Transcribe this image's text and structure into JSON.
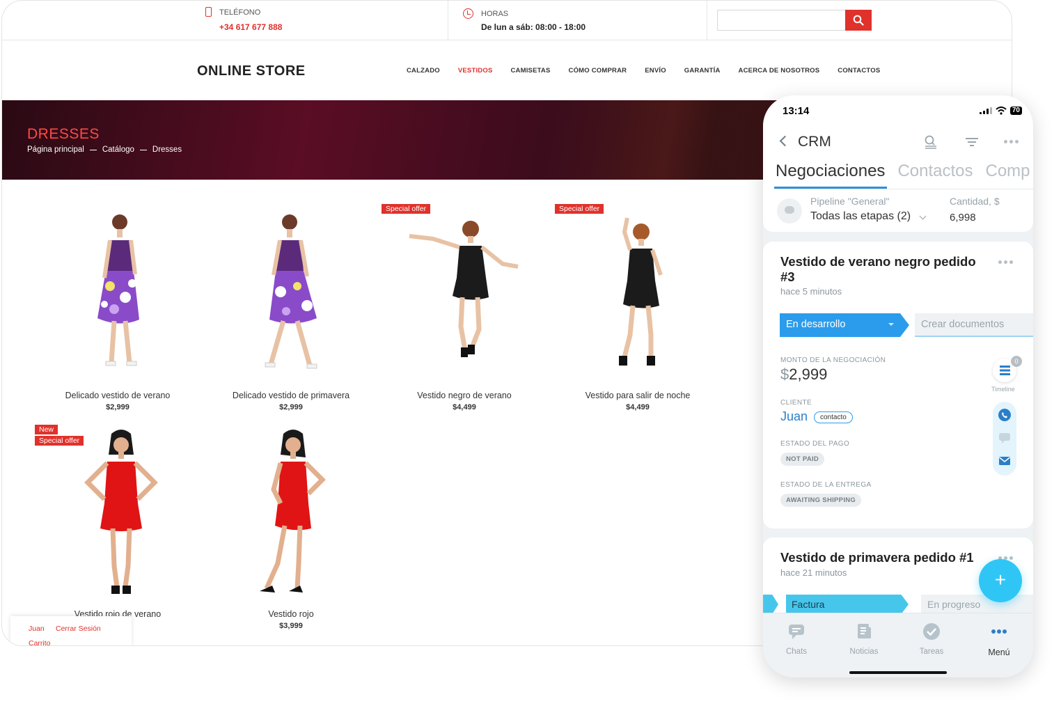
{
  "store": {
    "topbar": {
      "phone_label": "TELÉFONO",
      "phone_value": "+34 617 677 888",
      "hours_label": "HORAS",
      "hours_value": "De lun a sáb: 08:00 - 18:00",
      "search_placeholder": ""
    },
    "logo": "ONLINE STORE",
    "nav": [
      {
        "label": "CALZADO"
      },
      {
        "label": "VESTIDOS",
        "active": true
      },
      {
        "label": "CAMISETAS"
      },
      {
        "label": "CÓMO COMPRAR"
      },
      {
        "label": "ENVÍO"
      },
      {
        "label": "GARANTÍA"
      },
      {
        "label": "ACERCA DE NOSOTROS"
      },
      {
        "label": "CONTACTOS"
      }
    ],
    "hero": {
      "title": "DRESSES",
      "breadcrumb": [
        "Página principal",
        "Catálogo",
        "Dresses"
      ]
    },
    "products": [
      {
        "name": "Delicado vestido de verano",
        "price": "$2,999",
        "badges": []
      },
      {
        "name": "Delicado vestido de primavera",
        "price": "$2,999",
        "badges": []
      },
      {
        "name": "Vestido negro de verano",
        "price": "$4,499",
        "badges": [
          "Special offer"
        ]
      },
      {
        "name": "Vestido para salir de noche",
        "price": "$4,499",
        "badges": [
          "Special offer"
        ]
      },
      {
        "name": "Vestido rojo de verano",
        "price": "",
        "badges": [
          "New",
          "Special offer"
        ]
      },
      {
        "name": "Vestido rojo",
        "price": "$3,999",
        "badges": []
      }
    ],
    "user_strip": {
      "user": "Juan",
      "logout": "Cerrar Sesión",
      "cart": "Carrito"
    }
  },
  "crm": {
    "status": {
      "time": "13:14",
      "battery": "70"
    },
    "title": "CRM",
    "tabs": [
      {
        "label": "Negociaciones",
        "active": true
      },
      {
        "label": "Contactos"
      },
      {
        "label": "Comp"
      }
    ],
    "pipeline": {
      "label": "Pipeline \"General\"",
      "value": "Todas las etapas (2)",
      "amount_label": "Cantidad, $",
      "amount_value": "6,998"
    },
    "deals": [
      {
        "title": "Vestido de verano negro pedido #3",
        "time": "hace 5 minutos",
        "stage": "En desarrollo",
        "docs": "Crear documentos",
        "amount_label": "MONTO DE LA NEGOCIACIÓN",
        "amount_currency": "$",
        "amount": "2,999",
        "client_label": "CLIENTE",
        "client": "Juan",
        "client_tag": "contacto",
        "payment_label": "ESTADO DEL PAGO",
        "payment": "NOT PAID",
        "delivery_label": "ESTADO DE LA ENTREGA",
        "delivery": "AWAITING SHIPPING",
        "timeline_label": "Timeline",
        "timeline_count": "0"
      },
      {
        "title": "Vestido de primavera pedido #1",
        "time": "hace 21 minutos",
        "stage": "Factura",
        "next_stage": "En progreso"
      }
    ],
    "tabbar": [
      {
        "label": "Chats",
        "icon": "chat-icon"
      },
      {
        "label": "Noticias",
        "icon": "news-icon"
      },
      {
        "label": "Tareas",
        "icon": "tasks-icon"
      },
      {
        "label": "Menú",
        "icon": "menu-dots-icon",
        "active": true
      }
    ],
    "colors": {
      "accent": "#2b9ceb",
      "fab": "#2fc6f6",
      "store_red": "#e0312b"
    }
  }
}
